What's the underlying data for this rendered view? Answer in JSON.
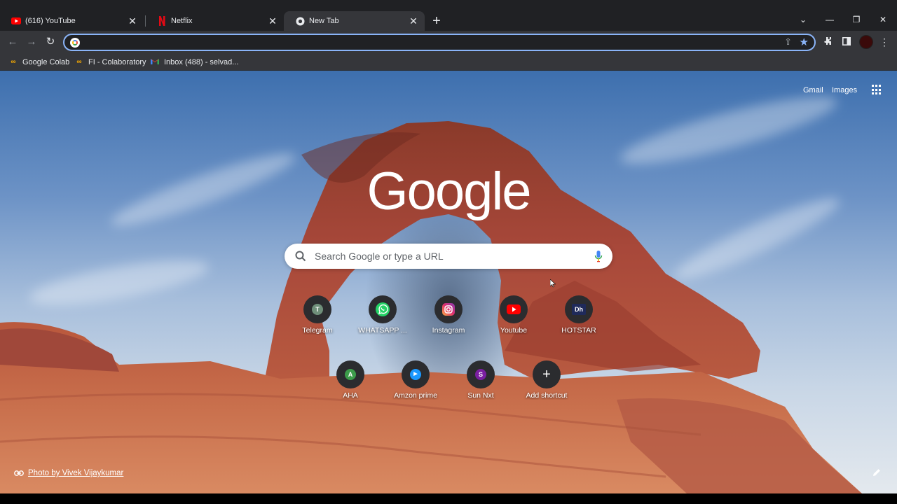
{
  "tabs": [
    {
      "title": "(616) YouTube",
      "icon": "youtube-icon",
      "active": false
    },
    {
      "title": "Netflix",
      "icon": "netflix-icon",
      "active": false
    },
    {
      "title": "New Tab",
      "icon": "chrome-icon",
      "active": true
    }
  ],
  "omnibox": {
    "value": ""
  },
  "bookmarks": [
    {
      "label": "Google Colab",
      "icon": "colab-icon"
    },
    {
      "label": "FI - Colaboratory",
      "icon": "colab-icon"
    },
    {
      "label": "Inbox (488) - selvad...",
      "icon": "gmail-icon"
    }
  ],
  "toplinks": {
    "gmail": "Gmail",
    "images": "Images"
  },
  "logo": "Google",
  "search": {
    "placeholder": "Search Google or type a URL"
  },
  "shortcuts_row1": [
    {
      "label": "Telegram",
      "letter": "T",
      "color": "#6f8f7a"
    },
    {
      "label": "WHATSAPP ...",
      "letter": "",
      "color": "#25d366"
    },
    {
      "label": "Instagram",
      "letter": "",
      "color": "#c13584"
    },
    {
      "label": "Youtube",
      "letter": "",
      "color": "#ff0000"
    },
    {
      "label": "HOTSTAR",
      "letter": "Dh",
      "color": "#1f2a5a"
    }
  ],
  "shortcuts_row2": [
    {
      "label": "AHA",
      "letter": "A",
      "color": "#3c9c4a"
    },
    {
      "label": "Amzon prime",
      "letter": "▶",
      "color": "#1a98ff"
    },
    {
      "label": "Sun Nxt",
      "letter": "S",
      "color": "#7b1fa2"
    },
    {
      "label": "Add shortcut",
      "letter": "+",
      "color": "#2b2c2f"
    }
  ],
  "credit": {
    "text": "Photo by Vivek Vijaykumar"
  }
}
